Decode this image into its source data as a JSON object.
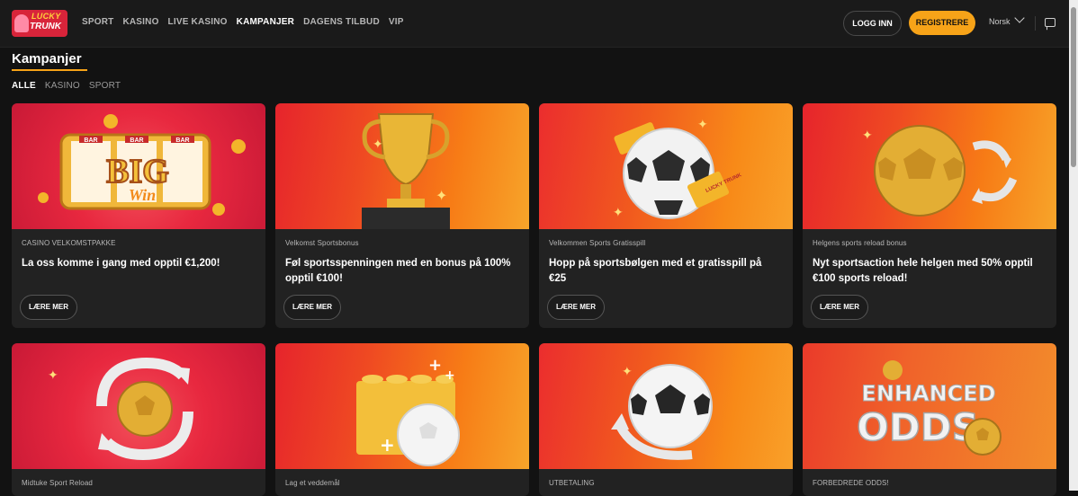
{
  "header": {
    "logo_line1": "LUCKY",
    "logo_line2": "TRUNK",
    "nav": [
      "SPORT",
      "KASINO",
      "LIVE KASINO",
      "KAMPANJER",
      "DAGENS TILBUD",
      "VIP"
    ],
    "active_nav": "KAMPANJER",
    "login_label": "LOGG INN",
    "register_label": "REGISTRERE",
    "language": "Norsk"
  },
  "page": {
    "title": "Kampanjer",
    "filters": [
      "ALLE",
      "KASINO",
      "SPORT"
    ],
    "active_filter": "ALLE"
  },
  "promotions": [
    {
      "tag": "CASINO VELKOMSTPAKKE",
      "title": "La oss komme i gang med opptil €1,200!",
      "button": "LÆRE MER",
      "art": "BIG WIN slot reels"
    },
    {
      "tag": "Velkomst Sportsbonus",
      "title": "Føl sportsspenningen med en bonus på 100% opptil €100!",
      "button": "LÆRE MER",
      "art": "gold trophy"
    },
    {
      "tag": "Velkommen Sports Gratisspill",
      "title": "Hopp på sportsbølgen med et gratisspill på €25",
      "button": "LÆRE MER",
      "art": "football with tickets"
    },
    {
      "tag": "Helgens sports reload bonus",
      "title": "Nyt sportsaction hele helgen med 50% opptil €100 sports reload!",
      "button": "LÆRE MER",
      "art": "gold football with reload arrows"
    },
    {
      "tag": "Midtuke Sport Reload",
      "title": "",
      "button": "",
      "art": "gold ball with reload arrows"
    },
    {
      "tag": "Lag et veddemål",
      "title": "",
      "button": "",
      "art": "lego brick with football"
    },
    {
      "tag": "UTBETALING",
      "title": "",
      "button": "",
      "art": "football with arrow"
    },
    {
      "tag": "FORBEDREDE ODDS!",
      "title": "",
      "button": "",
      "art": "ENHANCED ODDS"
    }
  ],
  "art_text": {
    "big": "BIG",
    "win": "Win",
    "bar": "BAR",
    "enhanced": "ENHANCED",
    "odds": "ODDS",
    "ticket_brand": "LUCKY TRUNK"
  },
  "colors": {
    "accent": "#f7a318",
    "background": "#121212",
    "card": "#222222"
  }
}
